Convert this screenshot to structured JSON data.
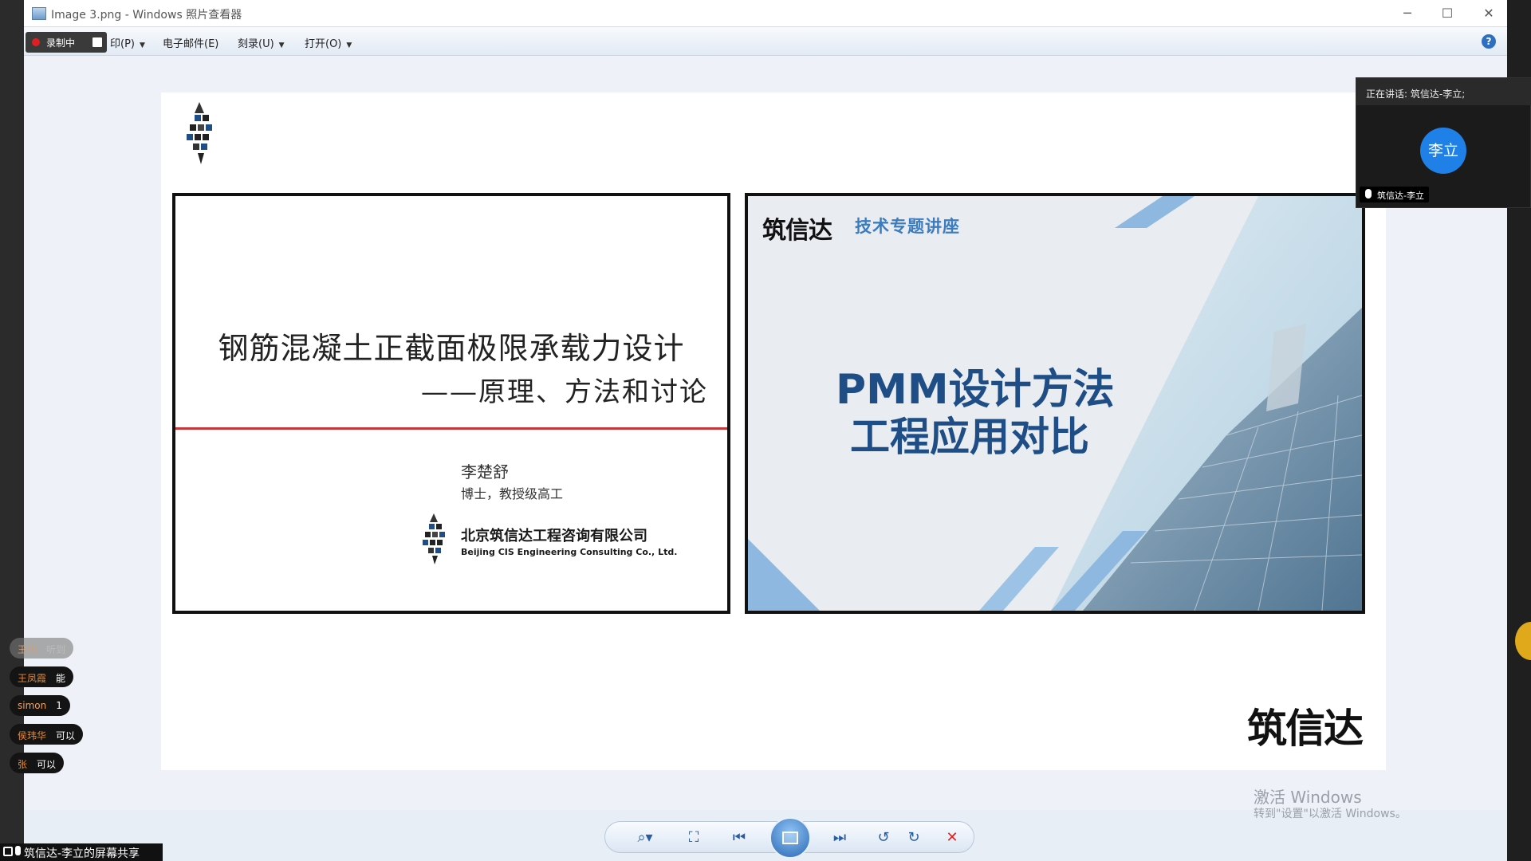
{
  "window": {
    "title": "Image 3.png - Windows 照片查看器",
    "minimize": "─",
    "maximize": "☐",
    "close": "✕"
  },
  "recording": {
    "label": "录制中"
  },
  "menu": {
    "print": "印(P)",
    "email": "电子邮件(E)",
    "burn": "刻录(U)",
    "open": "打开(O)",
    "caret": "▼",
    "help": "?"
  },
  "slide_left": {
    "title": "钢筋混凝土正截面极限承载力设计",
    "subtitle": "——原理、方法和讨论",
    "author": "李楚舒",
    "role": "博士，教授级高工",
    "company": "北京筑信达工程咨询有限公司",
    "company_en": "Beijing CIS Engineering Consulting Co., Ltd."
  },
  "slide_right": {
    "brand": "筑信达",
    "topic": "技术专题讲座",
    "title_line1": "PMM设计方法",
    "title_line2": "工程应用对比"
  },
  "bottom_logo": "筑信达",
  "watermark": {
    "line1": "激活 Windows",
    "line2": "转到\"设置\"以激活 Windows。"
  },
  "toolbar": {
    "zoom": "⌕▾",
    "fit": "⛶",
    "prev": "⏮",
    "next": "⏭",
    "rotate_ccw": "↺",
    "rotate_cw": "↻",
    "delete": "✕"
  },
  "speaker": {
    "now_speaking": "正在讲话: 筑信达-李立;",
    "avatar": "李立",
    "name": "筑信达-李立"
  },
  "chat": [
    {
      "name": "王川",
      "message": "听到"
    },
    {
      "name": "王凤霞",
      "message": "能"
    },
    {
      "name": "simon",
      "message": "1"
    },
    {
      "name": "侯玮华",
      "message": "可以"
    },
    {
      "name": "张",
      "message": "可以"
    }
  ],
  "share_bar": {
    "label": "筑信达-李立的屏幕共享"
  }
}
